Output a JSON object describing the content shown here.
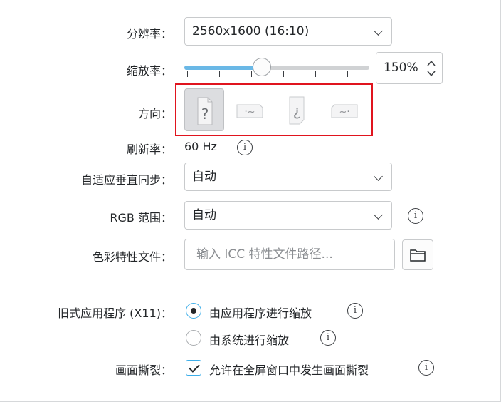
{
  "display": {
    "resolution": {
      "label": "分辨率：",
      "value": "2560x1600 (16:10)"
    },
    "scale": {
      "label": "缩放率：",
      "value": "150%",
      "slider_fraction": 0.42
    },
    "orientation": {
      "label": "方向：",
      "buttons": [
        {
          "glyph": "?",
          "selected": true
        },
        {
          "glyph": "·~",
          "selected": false
        },
        {
          "glyph": "¿",
          "selected": false
        },
        {
          "glyph": "~·",
          "selected": false
        }
      ]
    },
    "refresh": {
      "label": "刷新率：",
      "value": "60 Hz"
    },
    "vsync": {
      "label": "自适应垂直同步：",
      "value": "自动"
    },
    "rgb_range": {
      "label": "RGB 范围：",
      "value": "自动"
    },
    "color_profile": {
      "label": "色彩特性文件：",
      "placeholder": "输入 ICC 特性文件路径..."
    },
    "legacy": {
      "label": "旧式应用程序 (X11)：",
      "option_app": "由应用程序进行缩放",
      "option_system": "由系统进行缩放",
      "selected": "app"
    },
    "tearing": {
      "label": "画面撕裂：",
      "option": "允许在全屏窗口中发生画面撕裂",
      "checked": true
    },
    "info_glyph": "i"
  },
  "colors": {
    "accent": "#3daee9",
    "slider_fill": "#6ab8e6",
    "highlight_box": "#e0141e"
  }
}
